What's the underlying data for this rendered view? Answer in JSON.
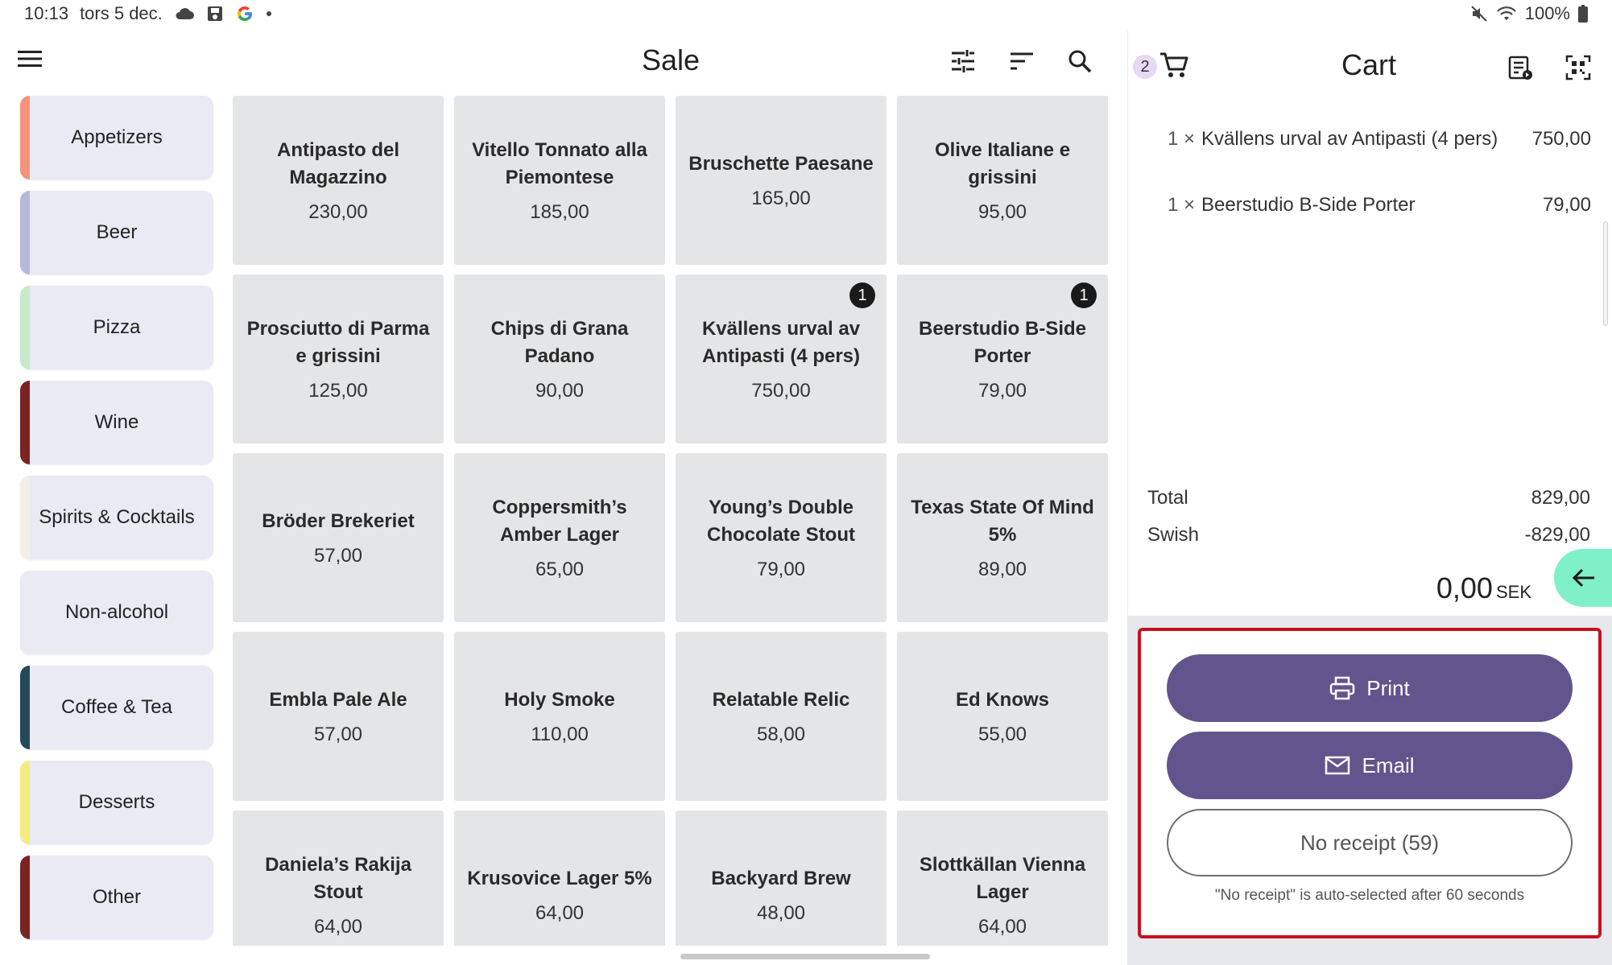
{
  "status_bar": {
    "time": "10:13",
    "date": "tors 5 dec.",
    "battery": "100%",
    "left_icons": [
      "cloud-icon",
      "save-icon",
      "google-icon",
      "dot-icon"
    ],
    "right_icons": [
      "mute-icon",
      "wifi-icon",
      "battery-icon"
    ]
  },
  "header": {
    "title": "Sale",
    "icons": [
      "menu-icon",
      "tune-icon",
      "sort-icon",
      "search-icon"
    ]
  },
  "categories": [
    {
      "label": "Appetizers",
      "color": "#f4937c"
    },
    {
      "label": "Beer",
      "color": "#b6b9dc"
    },
    {
      "label": "Pizza",
      "color": "#c7ebc9"
    },
    {
      "label": "Wine",
      "color": "#7a2424"
    },
    {
      "label": "Spirits & Cocktails",
      "color": "#f4efe6"
    },
    {
      "label": "Non-alcohol",
      "color": "#e9eaf3"
    },
    {
      "label": "Coffee & Tea",
      "color": "#24495a"
    },
    {
      "label": "Desserts",
      "color": "#f6ec7e"
    },
    {
      "label": "Other",
      "color": "#7a2424"
    }
  ],
  "products": [
    {
      "name": "Antipasto del Magazzino",
      "price": "230,00",
      "badge": ""
    },
    {
      "name": "Vitello Tonnato alla Piemontese",
      "price": "185,00",
      "badge": ""
    },
    {
      "name": "Bruschette Paesane",
      "price": "165,00",
      "badge": ""
    },
    {
      "name": "Olive Italiane e grissini",
      "price": "95,00",
      "badge": ""
    },
    {
      "name": "Prosciutto di Parma e grissini",
      "price": "125,00",
      "badge": ""
    },
    {
      "name": "Chips di Grana Padano",
      "price": "90,00",
      "badge": ""
    },
    {
      "name": "Kvällens urval av Antipasti (4 pers)",
      "price": "750,00",
      "badge": "1"
    },
    {
      "name": "Beerstudio B-Side Porter",
      "price": "79,00",
      "badge": "1"
    },
    {
      "name": "Bröder Brekeriet",
      "price": "57,00",
      "badge": ""
    },
    {
      "name": "Coppersmith’s Amber Lager",
      "price": "65,00",
      "badge": ""
    },
    {
      "name": "Young’s Double Chocolate Stout",
      "price": "79,00",
      "badge": ""
    },
    {
      "name": "Texas State Of Mind 5%",
      "price": "89,00",
      "badge": ""
    },
    {
      "name": "Embla Pale Ale",
      "price": "57,00",
      "badge": ""
    },
    {
      "name": "Holy Smoke",
      "price": "110,00",
      "badge": ""
    },
    {
      "name": "Relatable Relic",
      "price": "58,00",
      "badge": ""
    },
    {
      "name": "Ed Knows",
      "price": "55,00",
      "badge": ""
    },
    {
      "name": "Daniela’s Rakija Stout",
      "price": "64,00",
      "badge": ""
    },
    {
      "name": "Krusovice Lager 5%",
      "price": "64,00",
      "badge": ""
    },
    {
      "name": "Backyard Brew",
      "price": "48,00",
      "badge": ""
    },
    {
      "name": "Slottkällan Vienna Lager",
      "price": "64,00",
      "badge": ""
    }
  ],
  "cart": {
    "title": "Cart",
    "count": "2",
    "icons": [
      "cart-icon",
      "receipt-list-icon",
      "qr-scan-icon"
    ],
    "items": [
      {
        "qty": "1 ×",
        "name": "Kvällens urval av  Antipasti (4 pers)",
        "price": "750,00"
      },
      {
        "qty": "1 ×",
        "name": "Beerstudio B-Side Porter",
        "price": "79,00"
      }
    ],
    "total_label": "Total",
    "total_value": "829,00",
    "payment_label": "Swish",
    "payment_value": "-829,00",
    "remaining": "0,00",
    "currency": "SEK"
  },
  "receipt": {
    "print_label": "Print",
    "email_label": "Email",
    "no_receipt_label": "No receipt (59)",
    "note": "\"No receipt\" is auto-selected after 60 seconds",
    "accent_color": "#62548c",
    "highlight_color": "#c8101e"
  }
}
